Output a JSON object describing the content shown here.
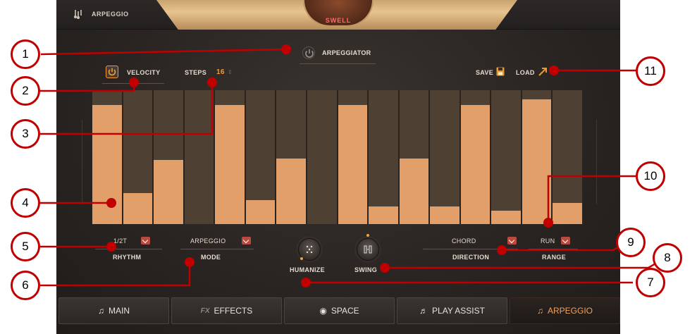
{
  "header": {
    "title": "ARPEGGIO",
    "preset": "SWELL"
  },
  "arpeggiator": {
    "label": "ARPEGGIATOR"
  },
  "velocity": {
    "label": "VELOCITY"
  },
  "steps": {
    "label": "STEPS",
    "value": "16"
  },
  "save": {
    "label": "SAVE"
  },
  "load": {
    "label": "LOAD"
  },
  "steps_levels": [
    0.89,
    0.23,
    0.48,
    0.0,
    0.89,
    0.18,
    0.49,
    0.0,
    0.89,
    0.13,
    0.49,
    0.13,
    0.89,
    0.1,
    0.93,
    0.16
  ],
  "rhythm": {
    "value": "1/2T",
    "label": "RHYTHM"
  },
  "mode": {
    "value": "ARPEGGIO",
    "label": "MODE"
  },
  "humanize": {
    "label": "HUMANIZE"
  },
  "swing": {
    "label": "SWING"
  },
  "direction": {
    "value": "CHORD",
    "label": "DIRECTION"
  },
  "range": {
    "value": "RUN",
    "label": "RANGE"
  },
  "tabs": [
    {
      "label": "MAIN",
      "icon": "guitar-icon"
    },
    {
      "label": "EFFECTS",
      "icon": "fx-icon"
    },
    {
      "label": "SPACE",
      "icon": "speaker-icon"
    },
    {
      "label": "PLAY ASSIST",
      "icon": "notes-icon"
    },
    {
      "label": "ARPEGGIO",
      "icon": "arpeggio-icon"
    }
  ],
  "annotations": [
    "1",
    "2",
    "3",
    "4",
    "5",
    "6",
    "7",
    "8",
    "9",
    "10",
    "11"
  ],
  "colors": {
    "accent": "#e39f6a",
    "annotation": "#c00000",
    "active_tab": "#f0a25a",
    "dropdown": "#b84a3f"
  }
}
